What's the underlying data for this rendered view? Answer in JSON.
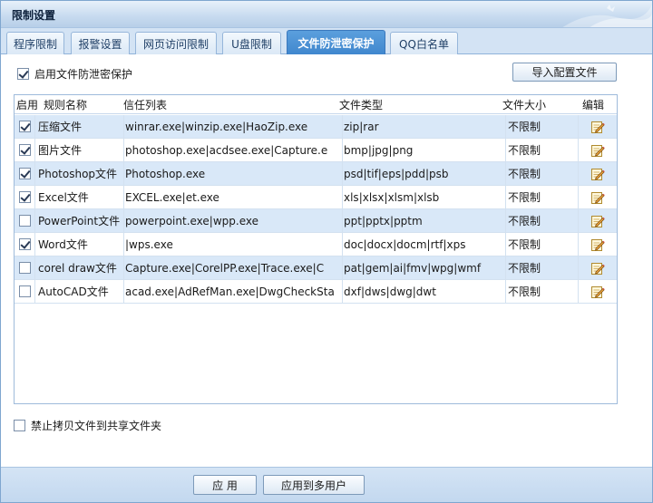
{
  "window": {
    "title": "限制设置"
  },
  "tabs": [
    {
      "label": "程序限制",
      "active": false
    },
    {
      "label": "报警设置",
      "active": false
    },
    {
      "label": "网页访问限制",
      "active": false
    },
    {
      "label": "U盘限制",
      "active": false
    },
    {
      "label": "文件防泄密保护",
      "active": true
    },
    {
      "label": "QQ白名单",
      "active": false
    }
  ],
  "protection": {
    "enable_label": "启用文件防泄密保护",
    "enabled": true,
    "import_button": "导入配置文件"
  },
  "table": {
    "headers": {
      "enable": "启用",
      "rule_name": "规则名称",
      "trust_list": "信任列表",
      "file_types": "文件类型",
      "file_size": "文件大小",
      "edit": "编辑"
    },
    "rows": [
      {
        "enabled": true,
        "name": "压缩文件",
        "trust": "winrar.exe|winzip.exe|HaoZip.exe",
        "types": "zip|rar",
        "size": "不限制",
        "edit_icon": "pencil-note-icon"
      },
      {
        "enabled": true,
        "name": "图片文件",
        "trust": "photoshop.exe|acdsee.exe|Capture.e",
        "types": "bmp|jpg|png",
        "size": "不限制",
        "edit_icon": "pencil-note-icon"
      },
      {
        "enabled": true,
        "name": "Photoshop文件",
        "trust": "Photoshop.exe",
        "types": "psd|tif|eps|pdd|psb",
        "size": "不限制",
        "edit_icon": "pencil-note-icon"
      },
      {
        "enabled": true,
        "name": "Excel文件",
        "trust": "EXCEL.exe|et.exe",
        "types": "xls|xlsx|xlsm|xlsb",
        "size": "不限制",
        "edit_icon": "pencil-note-icon"
      },
      {
        "enabled": false,
        "name": "PowerPoint文件",
        "trust": "powerpoint.exe|wpp.exe",
        "types": "ppt|pptx|pptm",
        "size": "不限制",
        "edit_icon": "pencil-note-icon"
      },
      {
        "enabled": true,
        "name": "Word文件",
        "trust": "|wps.exe",
        "types": "doc|docx|docm|rtf|xps",
        "size": "不限制",
        "edit_icon": "pencil-note-icon"
      },
      {
        "enabled": false,
        "name": "corel draw文件",
        "trust": "Capture.exe|CorelPP.exe|Trace.exe|C",
        "types": "pat|gem|ai|fmv|wpg|wmf",
        "size": "不限制",
        "edit_icon": "pencil-note-icon"
      },
      {
        "enabled": false,
        "name": "AutoCAD文件",
        "trust": "acad.exe|AdRefMan.exe|DwgCheckSta",
        "types": "dxf|dws|dwg|dwt",
        "size": "不限制",
        "edit_icon": "pencil-note-icon"
      }
    ]
  },
  "share": {
    "label": "禁止拷贝文件到共享文件夹",
    "checked": false
  },
  "footer": {
    "apply": "应 用",
    "apply_multi": "应用到多用户"
  },
  "colors": {
    "active_tab": "#4a90d6",
    "alt_row": "#d9e8f8",
    "titlebar": "#c9dcf0"
  }
}
